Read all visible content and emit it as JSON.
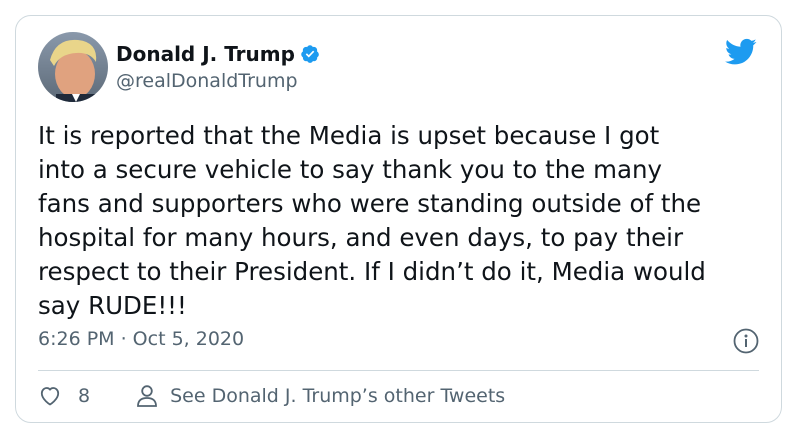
{
  "author": {
    "name": "Donald J. Trump",
    "handle": "@realDonaldTrump",
    "verified": true,
    "avatar_icon": "user-avatar"
  },
  "tweet": {
    "text": "It is reported that the Media is upset because I got\ninto a secure vehicle to say thank you to the many\nfans and supporters who were standing outside of the\nhospital for many hours, and even days, to pay their\nrespect to their President. If I didn’t do it, Media would\nsay RUDE!!!",
    "timestamp": "6:26 PM · Oct 5, 2020"
  },
  "actions": {
    "like_count": "8",
    "other_tweets_label": "See Donald J. Trump’s other Tweets"
  },
  "colors": {
    "brand": "#1d9bf0",
    "secondary_text": "#536471",
    "border": "#cfd9de"
  }
}
